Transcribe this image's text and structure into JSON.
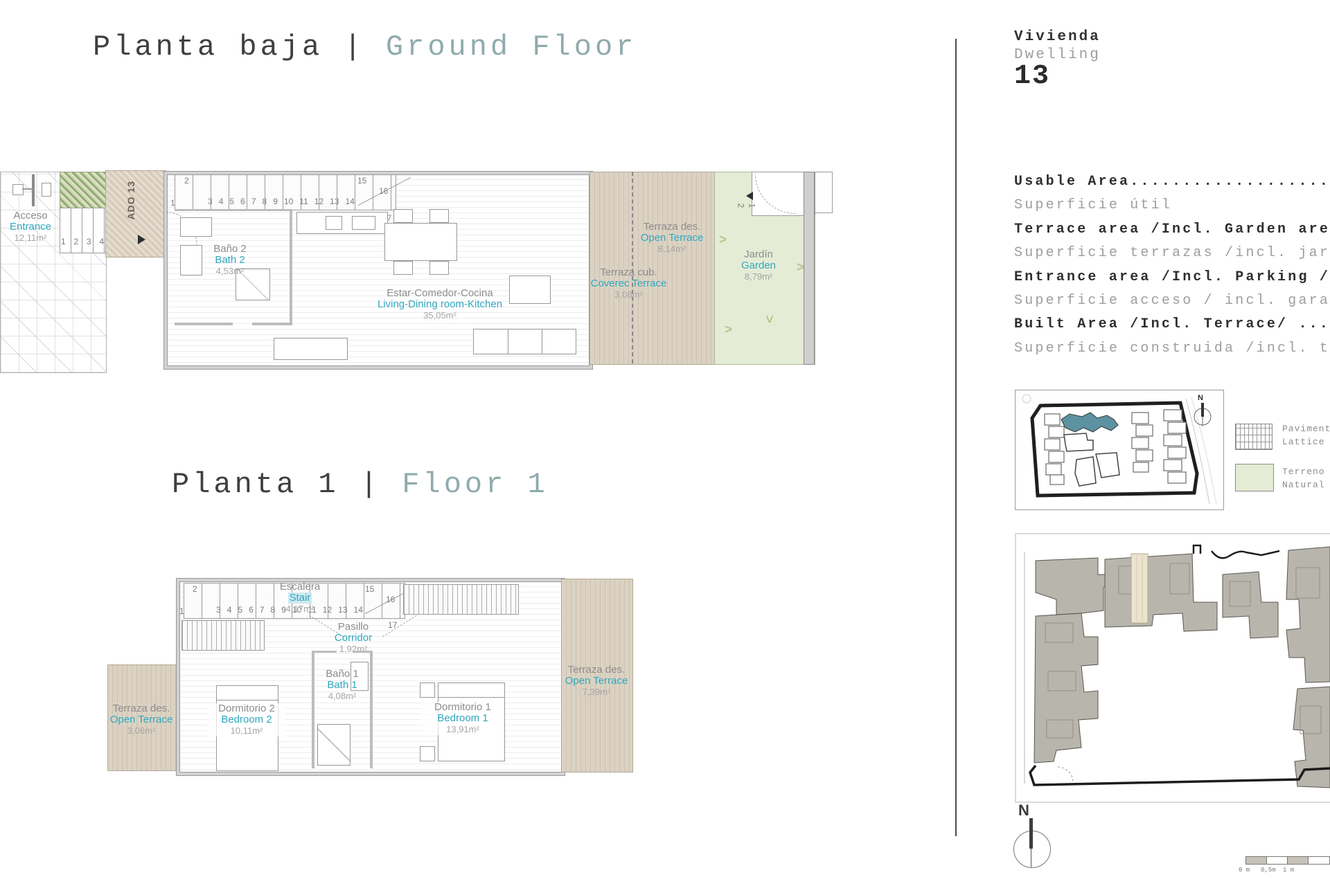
{
  "titles": {
    "ground": {
      "es": "Planta baja",
      "sep": "|",
      "en": "Ground Floor"
    },
    "first": {
      "es": "Planta 1",
      "sep": "|",
      "en": "Floor 1"
    }
  },
  "ground_floor": {
    "acceso": {
      "es": "Acceso",
      "en": "Entrance",
      "area": "12,11m²"
    },
    "ado_label": "ADO 13",
    "entrance_steps": [
      "1",
      "2",
      "3",
      "4"
    ],
    "stair": {
      "n1": "1",
      "n2": "2",
      "run": [
        "3",
        "4",
        "5",
        "6",
        "7",
        "8",
        "9",
        "10",
        "11",
        "12",
        "13",
        "14"
      ],
      "n15": "15",
      "n16": "16",
      "n17": "17"
    },
    "bano2": {
      "es": "Baño 2",
      "en": "Bath 2",
      "area": "4,53m²"
    },
    "living": {
      "es": "Estar-Comedor-Cocina",
      "en": "Living-Dining room-Kitchen",
      "area": "35,05m²"
    },
    "terraza_des": {
      "es": "Terraza des.",
      "en": "Open Terrace",
      "area": "8,14m²"
    },
    "terraza_cub": {
      "es": "Terraza cub.",
      "en": "Coverec Terrace",
      "area": "3,08m²"
    },
    "jardin": {
      "es": "Jardín",
      "en": "Garden",
      "area": "8,79m²"
    },
    "garden_steps": {
      "s1": "1",
      "s2": "2"
    }
  },
  "floor1": {
    "escalera": {
      "es": "Escalera",
      "en": "Stair",
      "area": "4,17m²"
    },
    "stair": {
      "n1": "1",
      "n2": "2",
      "run": [
        "3",
        "4",
        "5",
        "6",
        "7",
        "8",
        "9",
        "10",
        "11",
        "12",
        "13",
        "14"
      ],
      "n15": "15",
      "n16": "16",
      "n17": "17"
    },
    "pasillo": {
      "es": "Pasillo",
      "en": "Corridor",
      "area": "1,92m²"
    },
    "bano1": {
      "es": "Baño 1",
      "en": "Bath 1",
      "area": "4,08m²"
    },
    "dorm2": {
      "es": "Dormitorio 2",
      "en": "Bedroom 2",
      "area": "10,11m²"
    },
    "dorm1": {
      "es": "Dormitorio 1",
      "en": "Bedroom 1",
      "area": "13,91m²"
    },
    "terraza_left": {
      "es": "Terraza des.",
      "en": "Open Terrace",
      "area": "3,06m²"
    },
    "terraza_right": {
      "es": "Terraza des.",
      "en": "Open Terrace",
      "area": "7,39m²"
    }
  },
  "panel": {
    "vivienda": "Vivienda",
    "dwelling": "Dwelling",
    "number": "13",
    "areas": [
      {
        "en": "Usable Area..............................",
        "es": "Superficie útil"
      },
      {
        "en": "Terrace area /Incl. Garden area/ .......",
        "es": "Superficie terrazas /incl. jardín/"
      },
      {
        "en": "Entrance area /Incl. Parking /..........",
        "es": "Superficie acceso / incl. garaje /"
      },
      {
        "en": "Built Area /Incl. Terrace/ .............",
        "es": "Superficie construida /incl. terraza/"
      }
    ],
    "legend": [
      {
        "line1": "Pavimento",
        "line2": "Lattice"
      },
      {
        "line1": "Terreno",
        "line2": "Natural"
      }
    ],
    "compass_n": "N",
    "scale_labels": [
      "0 m",
      "0,5m",
      "1 m"
    ]
  },
  "colors": {
    "teal_label": "#2fa8bf",
    "muted_teal": "#8fabad",
    "terrace": "#dbd2c3",
    "garden": "#e5ecd6",
    "highlight": "#5d92a2"
  }
}
